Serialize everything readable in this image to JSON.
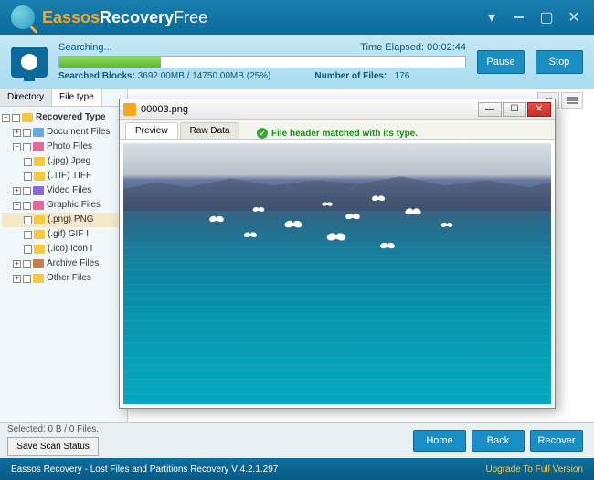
{
  "app": {
    "logo_part1": "Eassos",
    "logo_part2": "Recovery",
    "logo_part3": "Free"
  },
  "progress": {
    "searching_label": "Searching...",
    "time_elapsed_label": "Time Elapsed:",
    "time_elapsed_value": "00:02:44",
    "searched_label": "Searched Blocks:",
    "searched_value": "3692.00MB / 14750.00MB (25%)",
    "numfiles_label": "Number of Files:",
    "numfiles_value": "176",
    "pause": "Pause",
    "stop": "Stop"
  },
  "tabs": {
    "directory": "Directory",
    "filetype": "File type"
  },
  "tree": {
    "root": "Recovered Type",
    "doc": "Document Files",
    "photo": "Photo Files",
    "jpg": "(.jpg) Jpeg",
    "tif": "(.TIF) TIFF",
    "video": "Video Files",
    "graphic": "Graphic Files",
    "png": "(.png) PNG",
    "gif": "(.gif) GIF I",
    "ico": "(.ico) Icon I",
    "archive": "Archive Files",
    "other": "Other Files"
  },
  "footer": {
    "selected": "Selected: 0 B / 0 Files.",
    "save_scan": "Save Scan Status",
    "home": "Home",
    "back": "Back",
    "recover": "Recover",
    "status_line": "Eassos Recovery - Lost Files and Partitions Recovery  V 4.2.1.297",
    "upgrade": "Upgrade To Full Version"
  },
  "preview": {
    "title": "00003.png",
    "tab_preview": "Preview",
    "tab_raw": "Raw Data",
    "status": "File header matched with its type."
  }
}
